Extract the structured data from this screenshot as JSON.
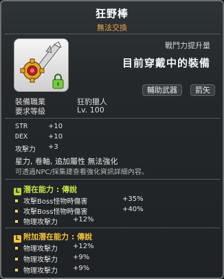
{
  "header": {
    "item_name": "狂野棒",
    "trade_status": "無法交換"
  },
  "item_icon": "lock-icon",
  "compare": {
    "rate_label": "戰鬥力提升量",
    "equip_status": "目前穿戴中的裝備"
  },
  "tags": [
    "輔助武器",
    "箭矢"
  ],
  "requirements": [
    {
      "label": "裝備職業",
      "value": "狂豹獵人"
    },
    {
      "label": "要求等級",
      "value": "Lv. 100"
    }
  ],
  "stats": [
    {
      "label": "STR",
      "value": "+10"
    },
    {
      "label": "DEX",
      "value": "+10"
    },
    {
      "label": "攻擊力",
      "value": "+3"
    }
  ],
  "notes": {
    "enhance_types": "星力, 卷軸, 追加屬性 無法強化",
    "enhance_hint": "可透過NPC/採集建查看強化資訊詳細內容。"
  },
  "potential": {
    "header": "潛在能力 : 傳說",
    "badge": "L",
    "lines": [
      {
        "text": "攻擊Boss怪物時傷害",
        "value": "+35%"
      },
      {
        "text": "攻擊Boss怪物時傷害",
        "value": "+40%"
      },
      {
        "text": "物理攻擊力",
        "value": "+12%"
      }
    ]
  },
  "additional_potential": {
    "header": "附加潛在能力 : 傳說",
    "badge": "L",
    "lines": [
      {
        "text": "物理攻擊力",
        "value": "+12%"
      },
      {
        "text": "物理攻擊力",
        "value": "+9%"
      },
      {
        "text": "物理攻擊力",
        "value": "+9%"
      }
    ]
  },
  "colors": {
    "title": "#ffffff",
    "trade_status": "#f2a64a",
    "potential_header": "#c7e04a",
    "additional_header": "#f0c23e",
    "bullet": "#f1d35c"
  }
}
